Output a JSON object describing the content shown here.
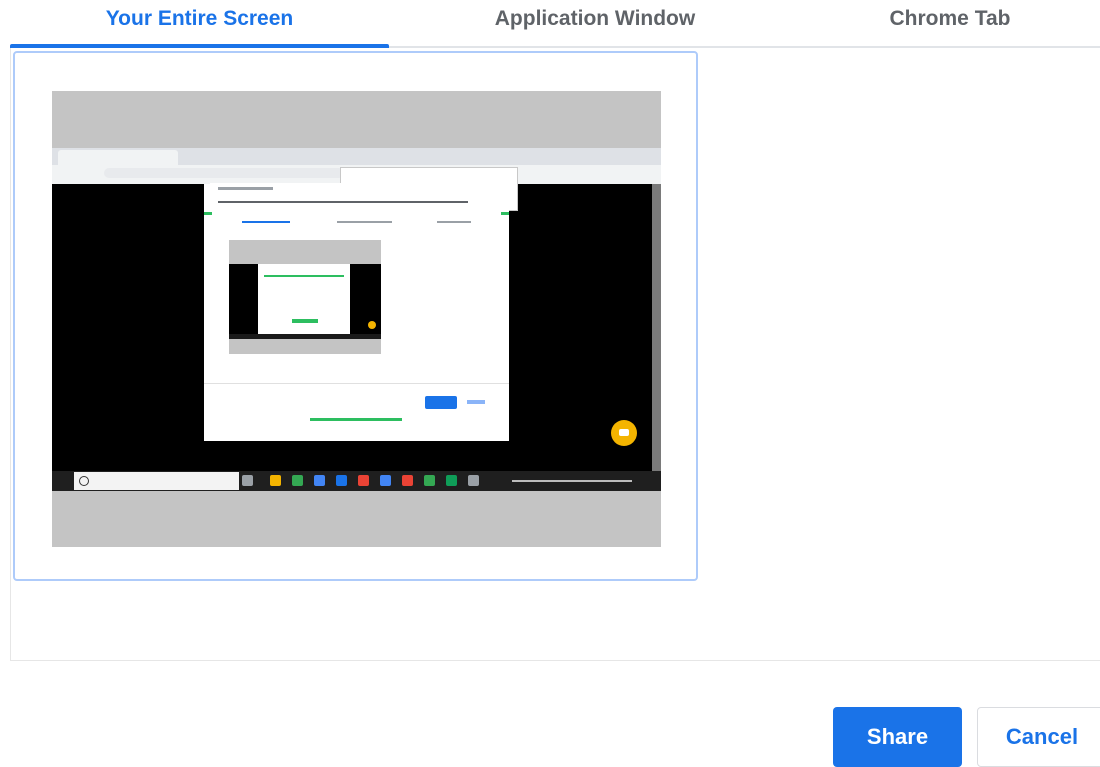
{
  "tabs": [
    {
      "label": "Your Entire Screen",
      "active": true
    },
    {
      "label": "Application Window",
      "active": false
    },
    {
      "label": "Chrome Tab",
      "active": false
    }
  ],
  "buttons": {
    "share_label": "Share",
    "cancel_label": "Cancel"
  },
  "colors": {
    "accent": "#1a73e8",
    "tab_inactive": "#5f6368",
    "selection_border": "#aecbfa"
  }
}
